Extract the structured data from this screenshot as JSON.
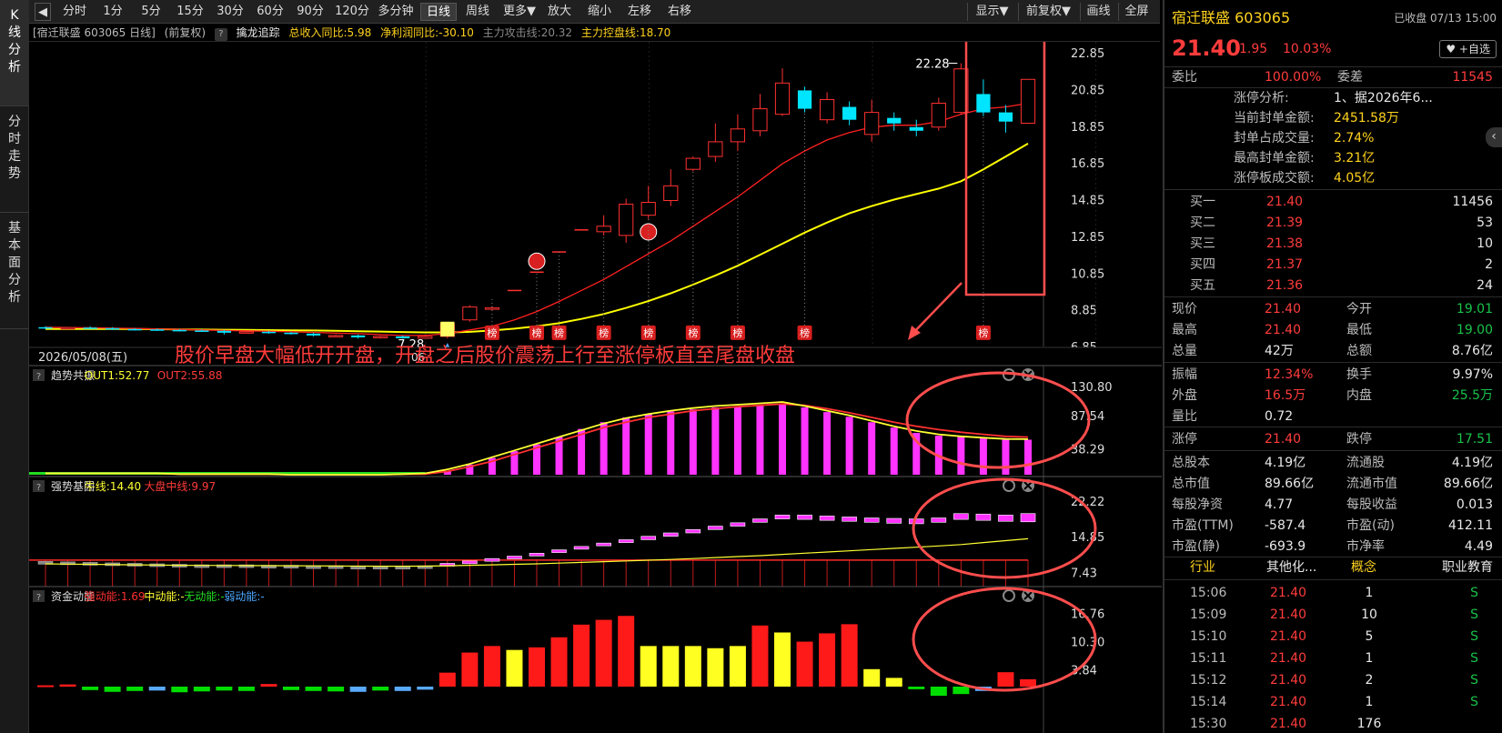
{
  "toolbar": {
    "back": "◀",
    "items": [
      "分时",
      "1分",
      "5分",
      "15分",
      "30分",
      "60分",
      "90分",
      "120分",
      "多分钟",
      "日线",
      "周线",
      "更多▼",
      "放大",
      "缩小",
      "左移",
      "右移"
    ],
    "active": "日线",
    "right_items": [
      "显示▼",
      "前复权▼",
      "画线",
      "全屏"
    ]
  },
  "sidetabs": [
    "K线分析",
    "分时走势",
    "基本面分析"
  ],
  "info_bar": {
    "stock": "[宿迁联盛 603065 日线]",
    "adjust": "(前复权)",
    "help": "?",
    "indicator": "擒龙追踪",
    "revenue": "总收入同比:5.98",
    "profit": "净利润同比:-30.10",
    "attack_line": "主力攻击线:20.32",
    "control_line": "主力控盘线:18.70"
  },
  "main_chart": {
    "y_ticks": [
      "22.85",
      "20.85",
      "18.85",
      "16.85",
      "14.85",
      "12.85",
      "10.85",
      "8.85",
      "6.85"
    ],
    "high_label": "22.28",
    "low_label": "7.28",
    "date_label": "2026/05/08(五)",
    "date_suffix": "06",
    "badge_text": "榜",
    "annotation": "股价早盘大幅低开开盘，开盘之后股价震荡上行至涨停板直至尾盘收盘",
    "colors": {
      "up": "#ff3030",
      "down": "#00e5ff",
      "ma_fast": "#ff2020",
      "ma_slow": "#ffff00",
      "highlight": "#ff4d4d"
    }
  },
  "panel1": {
    "help": "?",
    "name": "趋势共振",
    "out1": "OUT1:52.77",
    "out2": "OUT2:55.88",
    "y_ticks": [
      "130.80",
      "87.54",
      "38.29"
    ]
  },
  "panel2": {
    "help": "?",
    "name": "强势基因",
    "bull": "牛线:14.40",
    "market": "大盘中线:9.97",
    "y_ticks": [
      "22.22",
      "14.85",
      "7.43"
    ]
  },
  "panel3": {
    "help": "?",
    "name": "资金动能",
    "strong": "强动能:1.69",
    "mid": "中动能:-",
    "none": "无动能:-",
    "weak": "弱动能:-",
    "y_ticks": [
      "16.76",
      "10.30",
      "3.84"
    ]
  },
  "chart_data": {
    "type": "candlestick",
    "title": "宿迁联盛 603065 日线",
    "period": "日线",
    "adjust": "前复权",
    "y_range": [
      6.85,
      22.85
    ],
    "candles": [
      {
        "o": 7.9,
        "c": 7.85,
        "h": 7.95,
        "l": 7.8
      },
      {
        "o": 7.85,
        "c": 7.88,
        "h": 7.92,
        "l": 7.82
      },
      {
        "o": 7.88,
        "c": 7.85,
        "h": 7.95,
        "l": 7.8
      },
      {
        "o": 7.85,
        "c": 7.8,
        "h": 7.9,
        "l": 7.75
      },
      {
        "o": 7.8,
        "c": 7.78,
        "h": 7.85,
        "l": 7.72
      },
      {
        "o": 7.78,
        "c": 7.75,
        "h": 7.82,
        "l": 7.7
      },
      {
        "o": 7.75,
        "c": 7.72,
        "h": 7.8,
        "l": 7.68
      },
      {
        "o": 7.72,
        "c": 7.7,
        "h": 7.78,
        "l": 7.65
      },
      {
        "o": 7.7,
        "c": 7.6,
        "h": 7.75,
        "l": 7.5
      },
      {
        "o": 7.6,
        "c": 7.65,
        "h": 7.7,
        "l": 7.55
      },
      {
        "o": 7.65,
        "c": 7.6,
        "h": 7.7,
        "l": 7.55
      },
      {
        "o": 7.6,
        "c": 7.55,
        "h": 7.65,
        "l": 7.5
      },
      {
        "o": 7.55,
        "c": 7.45,
        "h": 7.6,
        "l": 7.4
      },
      {
        "o": 7.45,
        "c": 7.45,
        "h": 7.5,
        "l": 7.35
      },
      {
        "o": 7.45,
        "c": 7.35,
        "h": 7.5,
        "l": 7.28
      },
      {
        "o": 7.35,
        "c": 7.4,
        "h": 7.45,
        "l": 7.28
      },
      {
        "o": 7.4,
        "c": 7.3,
        "h": 7.45,
        "l": 7.28
      },
      {
        "o": 7.3,
        "c": 7.4,
        "h": 7.5,
        "l": 7.28
      },
      {
        "o": 7.4,
        "c": 8.1,
        "h": 8.2,
        "l": 7.3
      },
      {
        "o": 8.3,
        "c": 9.0,
        "h": 9.1,
        "l": 8.2
      },
      {
        "o": 8.9,
        "c": 8.95,
        "h": 9.05,
        "l": 8.8
      },
      {
        "o": 9.9,
        "c": 9.9,
        "h": 9.9,
        "l": 9.9
      },
      {
        "o": 10.9,
        "c": 10.9,
        "h": 10.9,
        "l": 10.9
      },
      {
        "o": 12.0,
        "c": 12.0,
        "h": 12.0,
        "l": 12.0
      },
      {
        "o": 13.2,
        "c": 13.2,
        "h": 13.2,
        "l": 13.2
      },
      {
        "o": 13.1,
        "c": 13.4,
        "h": 14.0,
        "l": 12.9
      },
      {
        "o": 12.9,
        "c": 14.6,
        "h": 14.9,
        "l": 12.5
      },
      {
        "o": 14.0,
        "c": 14.7,
        "h": 15.6,
        "l": 13.8
      },
      {
        "o": 14.8,
        "c": 15.6,
        "h": 16.5,
        "l": 14.5
      },
      {
        "o": 16.5,
        "c": 17.1,
        "h": 17.2,
        "l": 16.4
      },
      {
        "o": 17.2,
        "c": 18.0,
        "h": 19.0,
        "l": 16.9
      },
      {
        "o": 18.0,
        "c": 18.7,
        "h": 19.5,
        "l": 17.5
      },
      {
        "o": 18.6,
        "c": 19.8,
        "h": 20.6,
        "l": 18.3
      },
      {
        "o": 19.5,
        "c": 21.2,
        "h": 22.0,
        "l": 19.4
      },
      {
        "o": 20.8,
        "c": 19.8,
        "h": 21.0,
        "l": 19.6
      },
      {
        "o": 19.2,
        "c": 20.3,
        "h": 20.7,
        "l": 19.0
      },
      {
        "o": 19.9,
        "c": 19.2,
        "h": 20.2,
        "l": 18.9
      },
      {
        "o": 18.4,
        "c": 19.6,
        "h": 20.3,
        "l": 18.0
      },
      {
        "o": 19.3,
        "c": 19.0,
        "h": 19.6,
        "l": 18.6
      },
      {
        "o": 18.8,
        "c": 18.6,
        "h": 19.2,
        "l": 18.3
      },
      {
        "o": 18.8,
        "c": 20.1,
        "h": 20.4,
        "l": 18.6
      },
      {
        "o": 19.6,
        "c": 21.97,
        "h": 22.28,
        "l": 19.5
      },
      {
        "o": 20.6,
        "c": 19.6,
        "h": 21.4,
        "l": 19.4
      },
      {
        "o": 19.6,
        "c": 19.1,
        "h": 20.0,
        "l": 18.5
      },
      {
        "o": 19.01,
        "c": 21.4,
        "h": 21.4,
        "l": 19.0
      }
    ],
    "ma_fast": [
      7.9,
      7.88,
      7.87,
      7.85,
      7.83,
      7.8,
      7.78,
      7.75,
      7.72,
      7.7,
      7.68,
      7.65,
      7.62,
      7.58,
      7.55,
      7.5,
      7.45,
      7.45,
      7.55,
      7.75,
      7.95,
      8.3,
      8.75,
      9.3,
      9.9,
      10.5,
      11.2,
      11.9,
      12.6,
      13.4,
      14.2,
      15.0,
      15.9,
      16.8,
      17.5,
      18.1,
      18.5,
      18.8,
      18.9,
      18.9,
      19.1,
      19.5,
      19.8,
      19.9,
      20.1
    ],
    "ma_slow": [
      7.8,
      7.8,
      7.8,
      7.8,
      7.8,
      7.79,
      7.78,
      7.77,
      7.76,
      7.75,
      7.74,
      7.73,
      7.72,
      7.7,
      7.68,
      7.66,
      7.64,
      7.62,
      7.62,
      7.65,
      7.72,
      7.82,
      7.95,
      8.12,
      8.35,
      8.62,
      8.95,
      9.32,
      9.75,
      10.22,
      10.72,
      11.25,
      11.85,
      12.45,
      13.05,
      13.6,
      14.1,
      14.5,
      14.85,
      15.15,
      15.45,
      15.85,
      16.5,
      17.2,
      17.9
    ],
    "trend_bars": [
      2,
      2,
      2,
      2,
      2,
      2,
      2,
      2,
      2,
      2,
      2,
      2,
      2,
      2,
      2,
      2,
      2,
      2,
      6,
      15,
      25,
      35,
      45,
      56,
      68,
      78,
      85,
      90,
      94,
      97,
      100,
      102,
      104,
      106,
      100,
      93,
      86,
      78,
      70,
      62,
      58,
      56,
      54,
      52,
      52
    ],
    "trend_out1": [
      2,
      2,
      2,
      2,
      2,
      2,
      1,
      1,
      1,
      1,
      1,
      0,
      0,
      0,
      0,
      0,
      1,
      2,
      8,
      16,
      26,
      36,
      46,
      56,
      66,
      76,
      84,
      90,
      95,
      99,
      102,
      104,
      106,
      108,
      102,
      95,
      88,
      80,
      72,
      65,
      60,
      57,
      55,
      53,
      52.77
    ],
    "trend_out2": [
      2,
      2,
      2,
      2,
      2,
      2,
      1,
      1,
      1,
      1,
      1,
      0,
      0,
      0,
      0,
      0,
      1,
      1,
      5,
      12,
      20,
      30,
      40,
      50,
      60,
      70,
      78,
      85,
      90,
      95,
      98,
      101,
      103,
      105,
      103,
      98,
      92,
      85,
      78,
      72,
      67,
      63,
      60,
      57,
      55.88
    ],
    "gene_boxes": [
      {
        "a": 9.7,
        "b": 9.5
      },
      {
        "a": 9.6,
        "b": 9.4
      },
      {
        "a": 9.5,
        "b": 9.3
      },
      {
        "a": 9.4,
        "b": 9.2
      },
      {
        "a": 9.3,
        "b": 9.1
      },
      {
        "a": 9.2,
        "b": 9.0
      },
      {
        "a": 9.1,
        "b": 8.9
      },
      {
        "a": 9.0,
        "b": 8.8
      },
      {
        "a": 9.0,
        "b": 8.8
      },
      {
        "a": 9.0,
        "b": 8.8
      },
      {
        "a": 8.9,
        "b": 8.7
      },
      {
        "a": 8.9,
        "b": 8.7
      },
      {
        "a": 8.8,
        "b": 8.6
      },
      {
        "a": 8.8,
        "b": 8.6
      },
      {
        "a": 8.7,
        "b": 8.5
      },
      {
        "a": 8.7,
        "b": 8.5
      },
      {
        "a": 8.7,
        "b": 8.5
      },
      {
        "a": 8.8,
        "b": 8.6
      },
      {
        "a": 9.3,
        "b": 8.9
      },
      {
        "a": 9.8,
        "b": 9.4
      },
      {
        "a": 10.3,
        "b": 9.9
      },
      {
        "a": 10.8,
        "b": 10.4
      },
      {
        "a": 11.4,
        "b": 11.0
      },
      {
        "a": 12.1,
        "b": 11.6
      },
      {
        "a": 12.8,
        "b": 12.3
      },
      {
        "a": 13.5,
        "b": 13.0
      },
      {
        "a": 14.2,
        "b": 13.6
      },
      {
        "a": 14.9,
        "b": 14.2
      },
      {
        "a": 15.6,
        "b": 14.9
      },
      {
        "a": 16.3,
        "b": 15.6
      },
      {
        "a": 17.0,
        "b": 16.3
      },
      {
        "a": 17.7,
        "b": 17.0
      },
      {
        "a": 18.5,
        "b": 17.8
      },
      {
        "a": 19.3,
        "b": 18.5
      },
      {
        "a": 19.3,
        "b": 18.4
      },
      {
        "a": 19.1,
        "b": 18.2
      },
      {
        "a": 18.9,
        "b": 18.0
      },
      {
        "a": 18.7,
        "b": 17.8
      },
      {
        "a": 18.6,
        "b": 17.6
      },
      {
        "a": 18.5,
        "b": 17.5
      },
      {
        "a": 18.7,
        "b": 17.8
      },
      {
        "a": 19.6,
        "b": 18.4
      },
      {
        "a": 19.5,
        "b": 18.2
      },
      {
        "a": 19.3,
        "b": 18.0
      },
      {
        "a": 19.6,
        "b": 17.9
      }
    ],
    "gene_bull": [
      9.2,
      9.15,
      9.1,
      9.05,
      9.0,
      8.95,
      8.9,
      8.88,
      8.86,
      8.84,
      8.82,
      8.8,
      8.78,
      8.76,
      8.74,
      8.72,
      8.72,
      8.74,
      8.8,
      8.9,
      9.0,
      9.1,
      9.2,
      9.35,
      9.5,
      9.65,
      9.8,
      9.95,
      10.1,
      10.3,
      10.5,
      10.7,
      10.9,
      11.15,
      11.4,
      11.65,
      11.9,
      12.15,
      12.4,
      12.65,
      12.9,
      13.2,
      13.6,
      14.0,
      14.4
    ],
    "gene_market": [
      9.97
    ],
    "fund_bars": [
      0.3,
      0.5,
      -0.8,
      -1.2,
      -1.0,
      -0.9,
      -1.3,
      -1.1,
      -0.9,
      -1.0,
      0.6,
      -0.8,
      -1.0,
      -1.1,
      -1.2,
      -0.9,
      -1.0,
      -0.7,
      3.2,
      7.8,
      9.3,
      8.4,
      9.0,
      11.3,
      14.2,
      15.3,
      16.2,
      9.3,
      9.3,
      9.3,
      8.8,
      9.3,
      14.0,
      12.4,
      10.3,
      12.2,
      14.3,
      4.0,
      2.0,
      -0.6,
      -2.1,
      -1.7,
      -1.0,
      3.3,
      1.69
    ],
    "fund_colors": [
      "red",
      "red",
      "green",
      "green",
      "green",
      "blue",
      "green",
      "green",
      "green",
      "green",
      "red",
      "green",
      "green",
      "green",
      "blue",
      "green",
      "blue",
      "blue",
      "red",
      "red",
      "red",
      "yellow",
      "red",
      "red",
      "red",
      "red",
      "red",
      "yellow",
      "yellow",
      "yellow",
      "yellow",
      "yellow",
      "red",
      "yellow",
      "red",
      "red",
      "red",
      "yellow",
      "yellow",
      "green",
      "green",
      "green",
      "blue",
      "red",
      "red"
    ]
  },
  "right": {
    "name": "宿迁联盛 603065",
    "status": "已收盘 07/13 15:00",
    "price": "21.40",
    "change": "1.95",
    "pct": "10.03%",
    "fav": "♥ +自选",
    "weibi_label": "委比",
    "weibi": "100.00%",
    "weicha_label": "委差",
    "weicha": "11545",
    "limit_analysis": [
      {
        "k": "涨停分析:",
        "v": "1、据2026年6..."
      },
      {
        "k": "当前封单金额:",
        "v": "2451.58万"
      },
      {
        "k": "封单占成交量:",
        "v": "2.74%"
      },
      {
        "k": "最高封单金额:",
        "v": "3.21亿"
      },
      {
        "k": "涨停板成交额:",
        "v": "4.05亿"
      }
    ],
    "bids": [
      {
        "label": "买一",
        "price": "21.40",
        "vol": "11456"
      },
      {
        "label": "买二",
        "price": "21.39",
        "vol": "53"
      },
      {
        "label": "买三",
        "price": "21.38",
        "vol": "10"
      },
      {
        "label": "买四",
        "price": "21.37",
        "vol": "2"
      },
      {
        "label": "买五",
        "price": "21.36",
        "vol": "24"
      }
    ],
    "quote": [
      {
        "l1": "现价",
        "v1": "21.40",
        "c1": "red",
        "l2": "今开",
        "v2": "19.01",
        "c2": "grn"
      },
      {
        "l1": "最高",
        "v1": "21.40",
        "c1": "red",
        "l2": "最低",
        "v2": "19.00",
        "c2": "grn"
      },
      {
        "l1": "总量",
        "v1": "42万",
        "c1": "wht",
        "l2": "总额",
        "v2": "8.76亿",
        "c2": "wht"
      }
    ],
    "quote2": [
      {
        "l1": "振幅",
        "v1": "12.34%",
        "c1": "red",
        "l2": "换手",
        "v2": "9.97%",
        "c2": "wht"
      },
      {
        "l1": "外盘",
        "v1": "16.5万",
        "c1": "red",
        "l2": "内盘",
        "v2": "25.5万",
        "c2": "grn"
      },
      {
        "l1": "量比",
        "v1": "0.72",
        "c1": "wht",
        "l2": "",
        "v2": "",
        "c2": "wht"
      }
    ],
    "limits": {
      "l1": "涨停",
      "v1": "21.40",
      "l2": "跌停",
      "v2": "17.51"
    },
    "fund": [
      {
        "l1": "总股本",
        "v1": "4.19亿",
        "l2": "流通股",
        "v2": "4.19亿"
      },
      {
        "l1": "总市值",
        "v1": "89.66亿",
        "l2": "流通市值",
        "v2": "89.66亿"
      },
      {
        "l1": "每股净资",
        "v1": "4.77",
        "l2": "每股收益",
        "v2": "0.013"
      },
      {
        "l1": "市盈(TTM)",
        "v1": "-587.4",
        "l2": "市盈(动)",
        "v2": "412.11"
      },
      {
        "l1": "市盈(静)",
        "v1": "-693.9",
        "l2": "市净率",
        "v2": "4.49"
      }
    ],
    "industry": {
      "l1": "行业",
      "v1": "其他化...",
      "l2": "概念",
      "v2": "职业教育"
    },
    "ticks": [
      {
        "t": "15:06",
        "p": "21.40",
        "v": "1",
        "s": "S"
      },
      {
        "t": "15:09",
        "p": "21.40",
        "v": "10",
        "s": "S"
      },
      {
        "t": "15:10",
        "p": "21.40",
        "v": "5",
        "s": "S"
      },
      {
        "t": "15:11",
        "p": "21.40",
        "v": "1",
        "s": "S"
      },
      {
        "t": "15:12",
        "p": "21.40",
        "v": "2",
        "s": "S"
      },
      {
        "t": "15:14",
        "p": "21.40",
        "v": "1",
        "s": "S"
      },
      {
        "t": "15:30",
        "p": "21.40",
        "v": "176",
        "s": ""
      }
    ],
    "collapse": "‹"
  }
}
